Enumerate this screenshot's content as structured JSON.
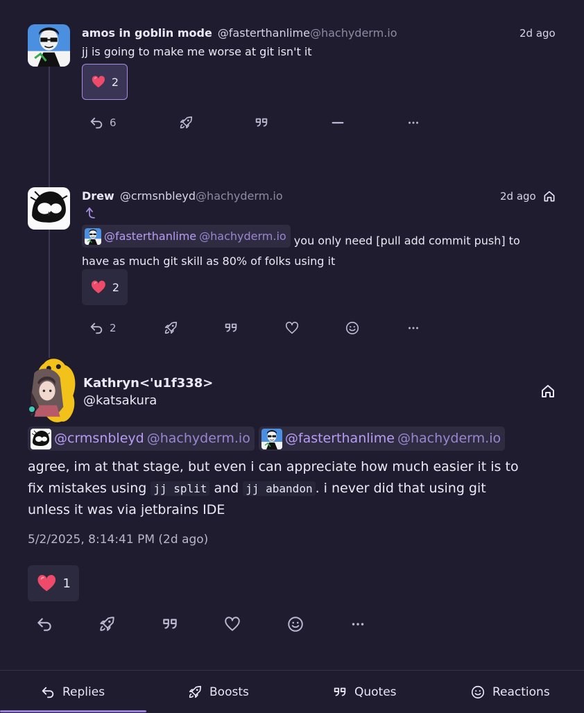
{
  "posts": [
    {
      "author_name": "amos in goblin mode",
      "handle_user": "@fasterthanlime",
      "handle_host": "@hachyderm.io",
      "time": "2d ago",
      "text": "jj is going to make me worse at git isn't it",
      "reaction_count": "2",
      "reply_count": "6"
    },
    {
      "author_name": "Drew",
      "handle_user": "@crmsnbleyd",
      "handle_host": "@hachyderm.io",
      "time": "2d ago",
      "mention_user": "@fasterthanlime",
      "mention_host": "@hachyderm.io",
      "text_1": " you only need [pull add commit push] to",
      "text_2": "have as much git skill as 80% of folks using it",
      "reaction_count": "2",
      "reply_count": "2"
    },
    {
      "author_name": "Kathryn<'u1f338>",
      "handle": "@katsakura",
      "mention1_user": "@crmsnbleyd",
      "mention1_host": "@hachyderm.io",
      "mention2_user": "@fasterthanlime",
      "mention2_host": "@hachyderm.io",
      "line1": "agree, im at that stage, but even i can appreciate how much easier it is to",
      "line2_a": "fix mistakes using ",
      "code1": "jj split",
      "line2_b": " and ",
      "code2": "jj abandon",
      "line2_c": ". i never did that using git",
      "line3": "unless it was via jetbrains IDE",
      "timestamp": "5/2/2025, 8:14:41 PM (2d ago)",
      "reaction_count": "1"
    }
  ],
  "tabs": [
    {
      "label": "Replies",
      "icon": "reply-icon",
      "active": true
    },
    {
      "label": "Boosts",
      "icon": "rocket-icon"
    },
    {
      "label": "Quotes",
      "icon": "quote-icon"
    },
    {
      "label": "Reactions",
      "icon": "smile-icon"
    }
  ],
  "colors": {
    "background": "#1e1c2e",
    "accent": "#9b7fdc",
    "heart": "#ee4a6a",
    "online": "#3fc7b2"
  }
}
